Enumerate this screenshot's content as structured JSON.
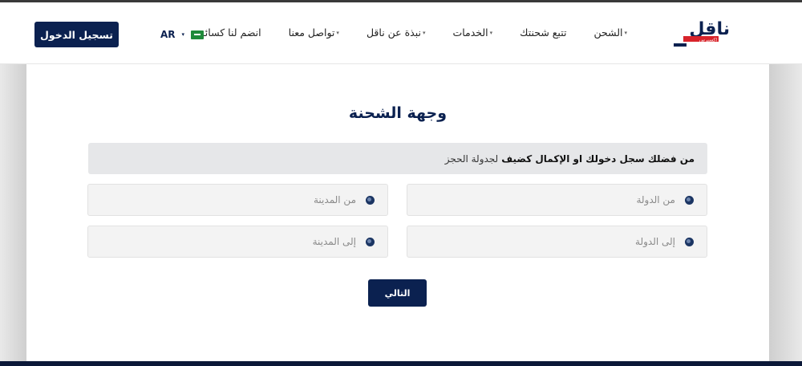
{
  "header": {
    "nav": [
      {
        "label": "الشحن",
        "caret": true
      },
      {
        "label": "تتبع شحنتك",
        "caret": false
      },
      {
        "label": "الخدمات",
        "caret": true
      },
      {
        "label": "نبذة عن ناقل",
        "caret": true
      },
      {
        "label": "تواصل معنا",
        "caret": true
      },
      {
        "label": "انضم لنا كسائق",
        "caret": false
      }
    ],
    "lang_code": "AR",
    "login_label": "تسجيل الدخول",
    "logo_text": "ناقل",
    "logo_sub": "اكسبرس"
  },
  "main": {
    "title": "وجهة الشحنة",
    "notice_bold": "من فضلك سجل دخولك او الإكمال كضيف",
    "notice_rest": "لجدولة الحجز",
    "fields": {
      "from_country": "من الدولة",
      "from_city": "من المدينة",
      "to_country": "إلى الدولة",
      "to_city": "إلى المدينة"
    },
    "next_label": "التالي"
  },
  "colors": {
    "brand_navy": "#0b2150",
    "brand_red": "#d8232a"
  }
}
